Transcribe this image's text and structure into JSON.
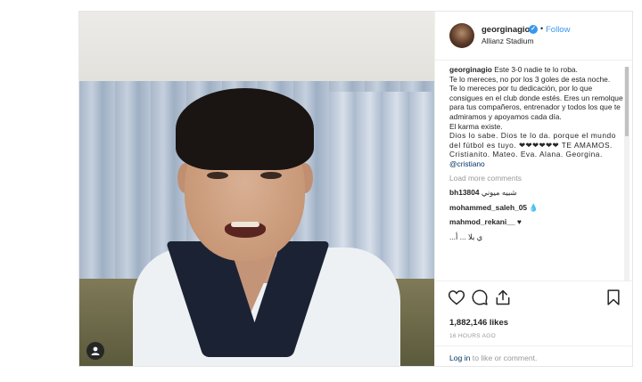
{
  "post": {
    "username": "georginagio",
    "verified_mark": "✓",
    "separator": "•",
    "follow_label": "Follow",
    "location": "Allianz Stadium"
  },
  "caption": {
    "username": "georginagio",
    "lines": [
      "Este 3-0 nadie te lo roba.",
      "Te lo mereces, no por los 3 goles de esta noche.",
      "Te lo mereces por tu dedicación, por lo que consigues en el club donde estés. Eres un remolque para tus compañeros, entrenador y todos los que te admiramos y apoyamos cada día.",
      "El karma existe.",
      "Dios lo sabe. Dios te lo da. porque el mundo del fútbol es tuyo. ❤❤❤❤❤❤ TE AMAMOS. Cristianito. Mateo. Eva. Alana. Georgina."
    ],
    "mention": "@cristiano"
  },
  "load_more_label": "Load more comments",
  "comments": [
    {
      "username": "bh13804",
      "text": "شبيه ميوني"
    },
    {
      "username": "mohammed_saleh_05",
      "text": "💧"
    },
    {
      "username": "mahmod_rekani__",
      "text": "♥"
    },
    {
      "username": "",
      "text": "...ي بلا ... أ"
    }
  ],
  "likes_text": "1,882,146 likes",
  "time_text": "16 HOURS AGO",
  "login": {
    "link_label": "Log in",
    "rest": " to like or comment."
  },
  "icons": {
    "heart": "heart-icon",
    "comment": "comment-icon",
    "share": "share-icon",
    "save": "bookmark-icon",
    "tag": "user-tag-icon"
  },
  "colors": {
    "accent": "#3897f0",
    "link": "#003569",
    "muted": "#999999",
    "text": "#262626"
  }
}
